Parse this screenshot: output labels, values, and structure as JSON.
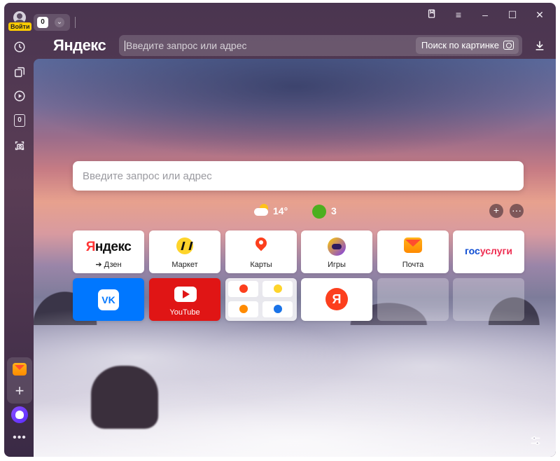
{
  "sidebar": {
    "login_label": "Войти",
    "history_icon": "history-icon",
    "tabs_icon": "tabs-icon",
    "video_icon": "play-icon",
    "counter_badge": "0",
    "screenshot_icon": "camera-icon",
    "add_label": "+",
    "more_label": "•••"
  },
  "topbar": {
    "tab_count": "0",
    "chevron": "⌄"
  },
  "window_controls": {
    "bookmarks": "bookmark-icon",
    "menu": "≡",
    "minimize": "–",
    "maximize": "☐",
    "close": "✕"
  },
  "header": {
    "brand": "Яндекс",
    "address_placeholder": "Введите запрос или адрес",
    "image_search_label": "Поиск по картинке"
  },
  "main": {
    "search_placeholder": "Введите запрос или адрес",
    "weather": {
      "temp": "14°"
    },
    "traffic": {
      "score": "3"
    },
    "add_btn": "+",
    "more_btn": "···"
  },
  "tiles": {
    "yandex": {
      "logo_y": "Я",
      "logo_rest": "ндекс",
      "label": "➔ Дзен"
    },
    "market": {
      "label": "Маркет"
    },
    "maps": {
      "label": "Карты"
    },
    "games": {
      "label": "Игры"
    },
    "mail": {
      "label": "Почта"
    },
    "gosuslugi": {
      "logo_a": "гос",
      "logo_b": "услуги"
    },
    "vk": {
      "logo": "VK"
    },
    "youtube": {
      "label": "YouTube"
    },
    "yandex_app": {
      "logo": "Я"
    }
  },
  "colors": {
    "accent_yellow": "#ffcc00",
    "vk_blue": "#0077ff",
    "youtube_red": "#e01515",
    "yandex_red": "#fc3f1d"
  }
}
